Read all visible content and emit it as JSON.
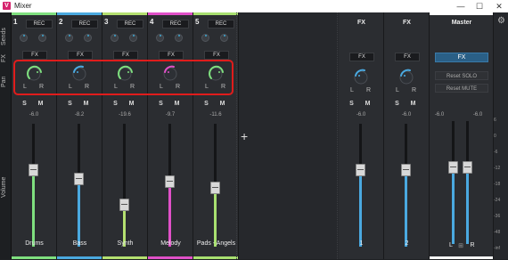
{
  "window": {
    "title": "Mixer",
    "logo_letter": "V",
    "minimize": "—",
    "maximize": "☐",
    "close": "✕"
  },
  "side_labels": [
    "Sends",
    "FX",
    "Pan",
    "Volume"
  ],
  "channels": [
    {
      "num": "1",
      "rec": "REC",
      "fx": "FX",
      "pan_l": "L",
      "pan_r": "R",
      "solo": "S",
      "mute": "M",
      "volume": "-6.0",
      "name": "Drums",
      "color": "#7fe07f",
      "level": 0.62
    },
    {
      "num": "2",
      "rec": "REC",
      "fx": "FX",
      "pan_l": "L",
      "pan_r": "R",
      "solo": "S",
      "mute": "M",
      "volume": "-8.2",
      "name": "Bass",
      "color": "#4aa9e0",
      "level": 0.55
    },
    {
      "num": "3",
      "rec": "REC",
      "fx": "FX",
      "pan_l": "L",
      "pan_r": "R",
      "solo": "S",
      "mute": "M",
      "volume": "-19.6",
      "name": "Synth",
      "color": "#b4e070",
      "level": 0.34
    },
    {
      "num": "4",
      "rec": "REC",
      "fx": "FX",
      "pan_l": "L",
      "pan_r": "R",
      "solo": "S",
      "mute": "M",
      "volume": "-9.7",
      "name": "Melody",
      "color": "#e050c8",
      "level": 0.53
    },
    {
      "num": "5",
      "rec": "REC",
      "fx": "FX",
      "pan_l": "L",
      "pan_r": "R",
      "solo": "S",
      "mute": "M",
      "volume": "-11.6",
      "name": "Pads - Angels",
      "color": "#a8e070",
      "level": 0.48
    }
  ],
  "add_strip": "+",
  "fx_channels": [
    {
      "title": "FX",
      "fx": "FX",
      "pan_l": "L",
      "pan_r": "R",
      "solo": "S",
      "mute": "M",
      "volume": "-6.0",
      "name": "1",
      "color": "#4aa9e0",
      "level": 0.62
    },
    {
      "title": "FX",
      "fx": "FX",
      "pan_l": "L",
      "pan_r": "R",
      "solo": "S",
      "mute": "M",
      "volume": "-6.0",
      "name": "2",
      "color": "#4aa9e0",
      "level": 0.62
    }
  ],
  "master": {
    "title": "Master",
    "fx": "FX",
    "reset_solo": "Reset SOLO",
    "reset_mute": "Reset MUTE",
    "vol_l": "-6.0",
    "vol_r": "-6.0",
    "label_l": "L",
    "label_link": "⊞",
    "label_r": "R",
    "accent": "#2a5f86",
    "level": 0.62
  },
  "scale": [
    "6",
    "0",
    "-6",
    "-12",
    "-18",
    "-24",
    "-36",
    "-48",
    "-inf"
  ],
  "settings_icon": "⚙"
}
